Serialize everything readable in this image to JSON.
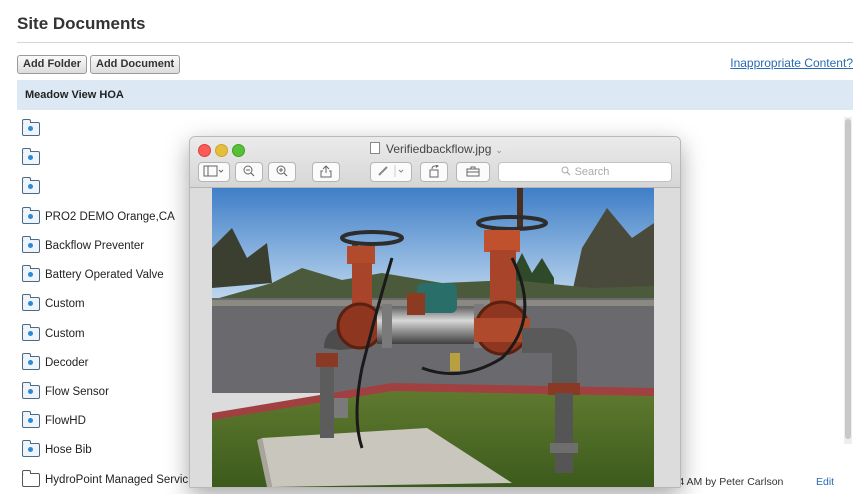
{
  "page": {
    "title": "Site Documents",
    "buttons": {
      "add_folder": "Add Folder",
      "add_document": "Add Document"
    },
    "link": "Inappropriate Content?",
    "group": "Meadow View HOA"
  },
  "documents": [
    {
      "label": "",
      "icon": "camera-folder-icon"
    },
    {
      "label": "",
      "icon": "camera-folder-icon"
    },
    {
      "label": "",
      "icon": "camera-folder-icon"
    },
    {
      "label": "PRO2 DEMO Orange,CA",
      "icon": "camera-folder-icon"
    },
    {
      "label": "Backflow Preventer",
      "icon": "camera-folder-icon"
    },
    {
      "label": "Battery Operated Valve",
      "icon": "camera-folder-icon"
    },
    {
      "label": "Custom",
      "icon": "camera-folder-icon"
    },
    {
      "label": "Custom",
      "icon": "camera-folder-icon"
    },
    {
      "label": "Decoder",
      "icon": "camera-folder-icon"
    },
    {
      "label": "Flow Sensor",
      "icon": "camera-folder-icon"
    },
    {
      "label": "FlowHD",
      "icon": "camera-folder-icon"
    },
    {
      "label": "Hose Bib",
      "icon": "camera-folder-icon"
    },
    {
      "label": "HydroPoint Managed Servic",
      "icon": "folder-icon"
    }
  ],
  "last_row": {
    "meta": "3 9:44 AM by Peter Carlson",
    "edit": "Edit"
  },
  "preview": {
    "filename": "Verifiedbackflow.jpg",
    "search_placeholder": "Search",
    "colors": {
      "close": "#fc5b57",
      "minimize": "#e5bf3c",
      "maximize": "#57c038"
    }
  },
  "colors": {
    "group_bar": "#dce9f5",
    "link": "#2a6bb5",
    "valve_red": "#9e3a22"
  }
}
